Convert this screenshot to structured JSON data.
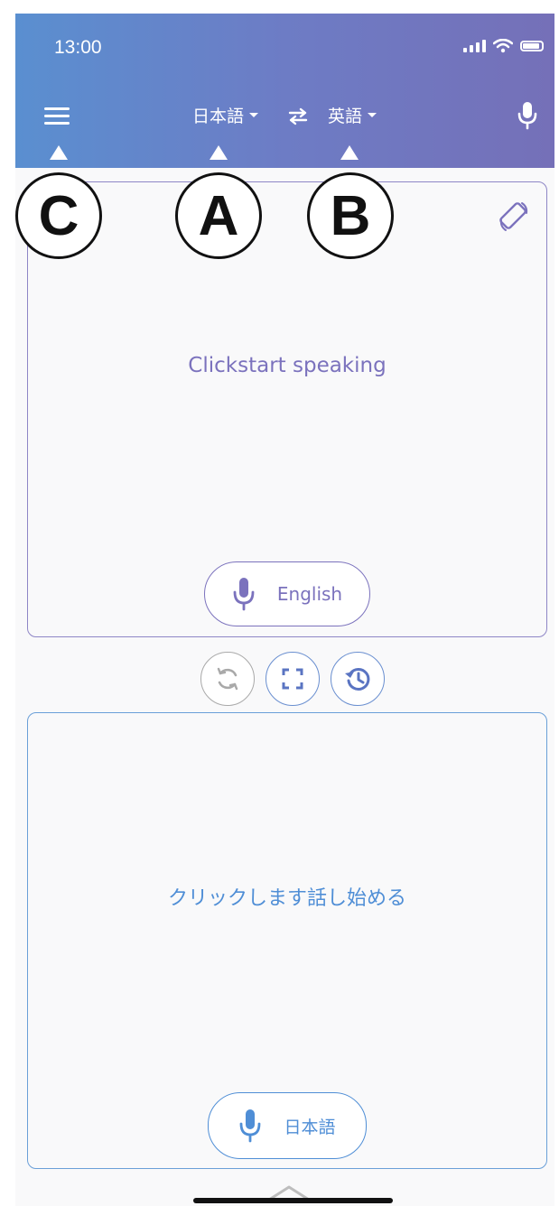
{
  "status_bar": {
    "time": "13:00"
  },
  "header": {
    "source_language": "日本語",
    "target_language": "英語"
  },
  "callouts": {
    "a": "A",
    "b": "B",
    "c": "C"
  },
  "top_panel": {
    "prompt": "Clickstart speaking",
    "button_label": "English"
  },
  "bottom_panel": {
    "prompt": "クリックします話し始める",
    "button_label": "日本語"
  },
  "icons": {
    "menu": "menu-icon",
    "swap": "swap-icon",
    "header_mic": "microphone-icon",
    "rotate": "screen-rotation-icon",
    "refresh": "refresh-icon",
    "fullscreen": "fullscreen-icon",
    "history": "history-icon"
  },
  "colors": {
    "header_start": "#5a8fd0",
    "header_end": "#7570b8",
    "purple": "#7b72bd",
    "blue": "#4f8ed6"
  }
}
